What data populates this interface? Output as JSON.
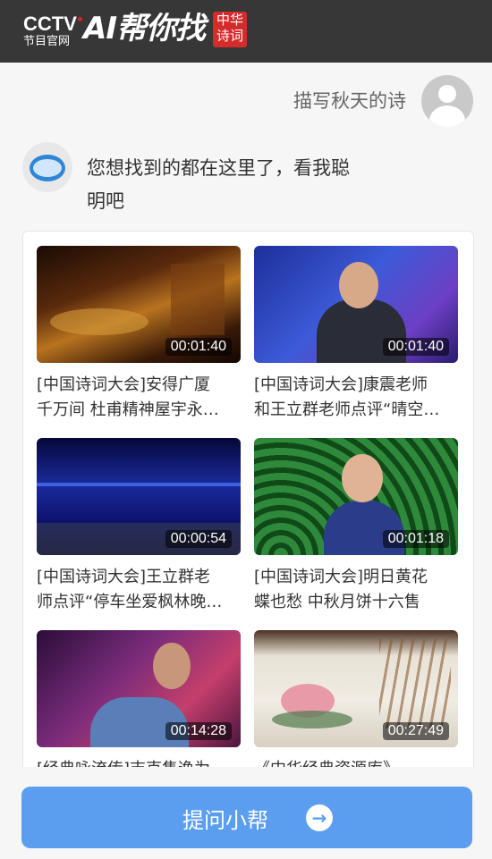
{
  "header": {
    "brand": "CCTV",
    "brand_sub": "节目官网",
    "app_name": "AI帮你找",
    "seal_line1": "中华",
    "seal_line2": "诗词"
  },
  "chat": {
    "user_query": "描写秋天的诗",
    "bot_reply_line1": "您想找到的都在这里了，看我聪",
    "bot_reply_line2": "明吧"
  },
  "videos": [
    {
      "duration": "00:01:40",
      "title_line1": "[中国诗词大会]安得广厦",
      "title_line2": "千万间 杜甫精神屋宇永…"
    },
    {
      "duration": "00:01:40",
      "title_line1": "[中国诗词大会]康震老师",
      "title_line2": "和王立群老师点评“晴空…"
    },
    {
      "duration": "00:00:54",
      "title_line1": "[中国诗词大会]王立群老",
      "title_line2": "师点评“停车坐爱枫林晚…"
    },
    {
      "duration": "00:01:18",
      "title_line1": "[中国诗词大会]明日黄花",
      "title_line2": "蝶也愁 中秋月饼十六售"
    },
    {
      "duration": "00:14:28",
      "title_line1": "[经典咏流传]吉克隽逸为",
      "title_line2": ""
    },
    {
      "duration": "00:27:49",
      "title_line1": "《中华经典资源库》",
      "title_line2": ""
    }
  ],
  "ask_button": {
    "label": "提问小帮",
    "icon": "arrow-right-circle-icon"
  }
}
